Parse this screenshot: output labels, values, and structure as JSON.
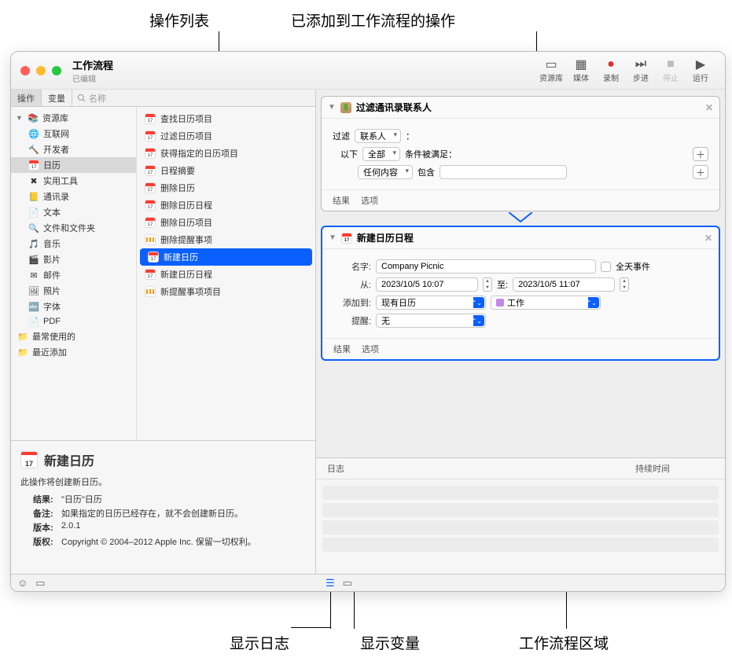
{
  "callouts": {
    "top_left": "操作列表",
    "top_right": "已添加到工作流程的操作",
    "bottom_1": "显示日志",
    "bottom_2": "显示变量",
    "bottom_3": "工作流程区域"
  },
  "titlebar": {
    "title": "工作流程",
    "subtitle": "已编辑"
  },
  "toolbar": {
    "library": "资源库",
    "media": "媒体",
    "record": "录制",
    "step": "步进",
    "stop": "停止",
    "run": "运行"
  },
  "left_tabs": {
    "actions": "操作",
    "variables": "变量",
    "search_placeholder": "名称"
  },
  "library": {
    "header": "资源库",
    "items": [
      {
        "label": "互联网",
        "icon": "🌐"
      },
      {
        "label": "开发者",
        "icon": "🔨"
      },
      {
        "label": "日历",
        "icon": "cal",
        "selected": true
      },
      {
        "label": "实用工具",
        "icon": "✖"
      },
      {
        "label": "通讯录",
        "icon": "📒"
      },
      {
        "label": "文本",
        "icon": "📄"
      },
      {
        "label": "文件和文件夹",
        "icon": "🔍"
      },
      {
        "label": "音乐",
        "icon": "🎵"
      },
      {
        "label": "影片",
        "icon": "🎬"
      },
      {
        "label": "邮件",
        "icon": "✉"
      },
      {
        "label": "照片",
        "icon": "🖼"
      },
      {
        "label": "字体",
        "icon": "🔤"
      },
      {
        "label": "PDF",
        "icon": "📄"
      }
    ],
    "smart": [
      {
        "label": "最常使用的"
      },
      {
        "label": "最近添加"
      }
    ]
  },
  "actions_list": [
    {
      "label": "查找日历项目",
      "icon": "cal"
    },
    {
      "label": "过滤日历项目",
      "icon": "cal"
    },
    {
      "label": "获得指定的日历项目",
      "icon": "cal"
    },
    {
      "label": "日程摘要",
      "icon": "cal"
    },
    {
      "label": "删除日历",
      "icon": "cal"
    },
    {
      "label": "删除日历日程",
      "icon": "cal"
    },
    {
      "label": "删除日历项目",
      "icon": "cal"
    },
    {
      "label": "删除提醒事项",
      "icon": "rem"
    },
    {
      "label": "新建日历",
      "icon": "cal",
      "selected": true
    },
    {
      "label": "新建日历日程",
      "icon": "cal"
    },
    {
      "label": "新提醒事项项目",
      "icon": "rem"
    }
  ],
  "info": {
    "title": "新建日历",
    "description": "此操作将创建新日历。",
    "result_k": "结果:",
    "result_v": "\"日历\"日历",
    "note_k": "备注:",
    "note_v": "如果指定的日历已经存在，就不会创建新日历。",
    "version_k": "版本:",
    "version_v": "2.0.1",
    "copyright_k": "版权:",
    "copyright_v": "Copyright © 2004–2012 Apple Inc. 保留一切权利。"
  },
  "wf1": {
    "title": "过滤通讯录联系人",
    "filter_lbl": "过滤",
    "filter_val": "联系人",
    "colon": "：",
    "yi_xia": "以下",
    "all": "全部",
    "cond_suffix": "条件被满足：",
    "any_content": "任何内容",
    "contains": "包含",
    "results": "结果",
    "options": "选项"
  },
  "wf2": {
    "title": "新建日历日程",
    "name_lbl": "名字:",
    "name_val": "Company Picnic",
    "allday": "全天事件",
    "from_lbl": "从:",
    "from_val": "2023/10/5 10:07",
    "to_lbl": "至:",
    "to_val": "2023/10/5 11:07",
    "addto_lbl": "添加到:",
    "addto_val": "现有日历",
    "cal_val": "工作",
    "remind_lbl": "提醒:",
    "remind_val": "无",
    "results": "结果",
    "options": "选项"
  },
  "log": {
    "col1": "日志",
    "col2": "持续时间"
  }
}
